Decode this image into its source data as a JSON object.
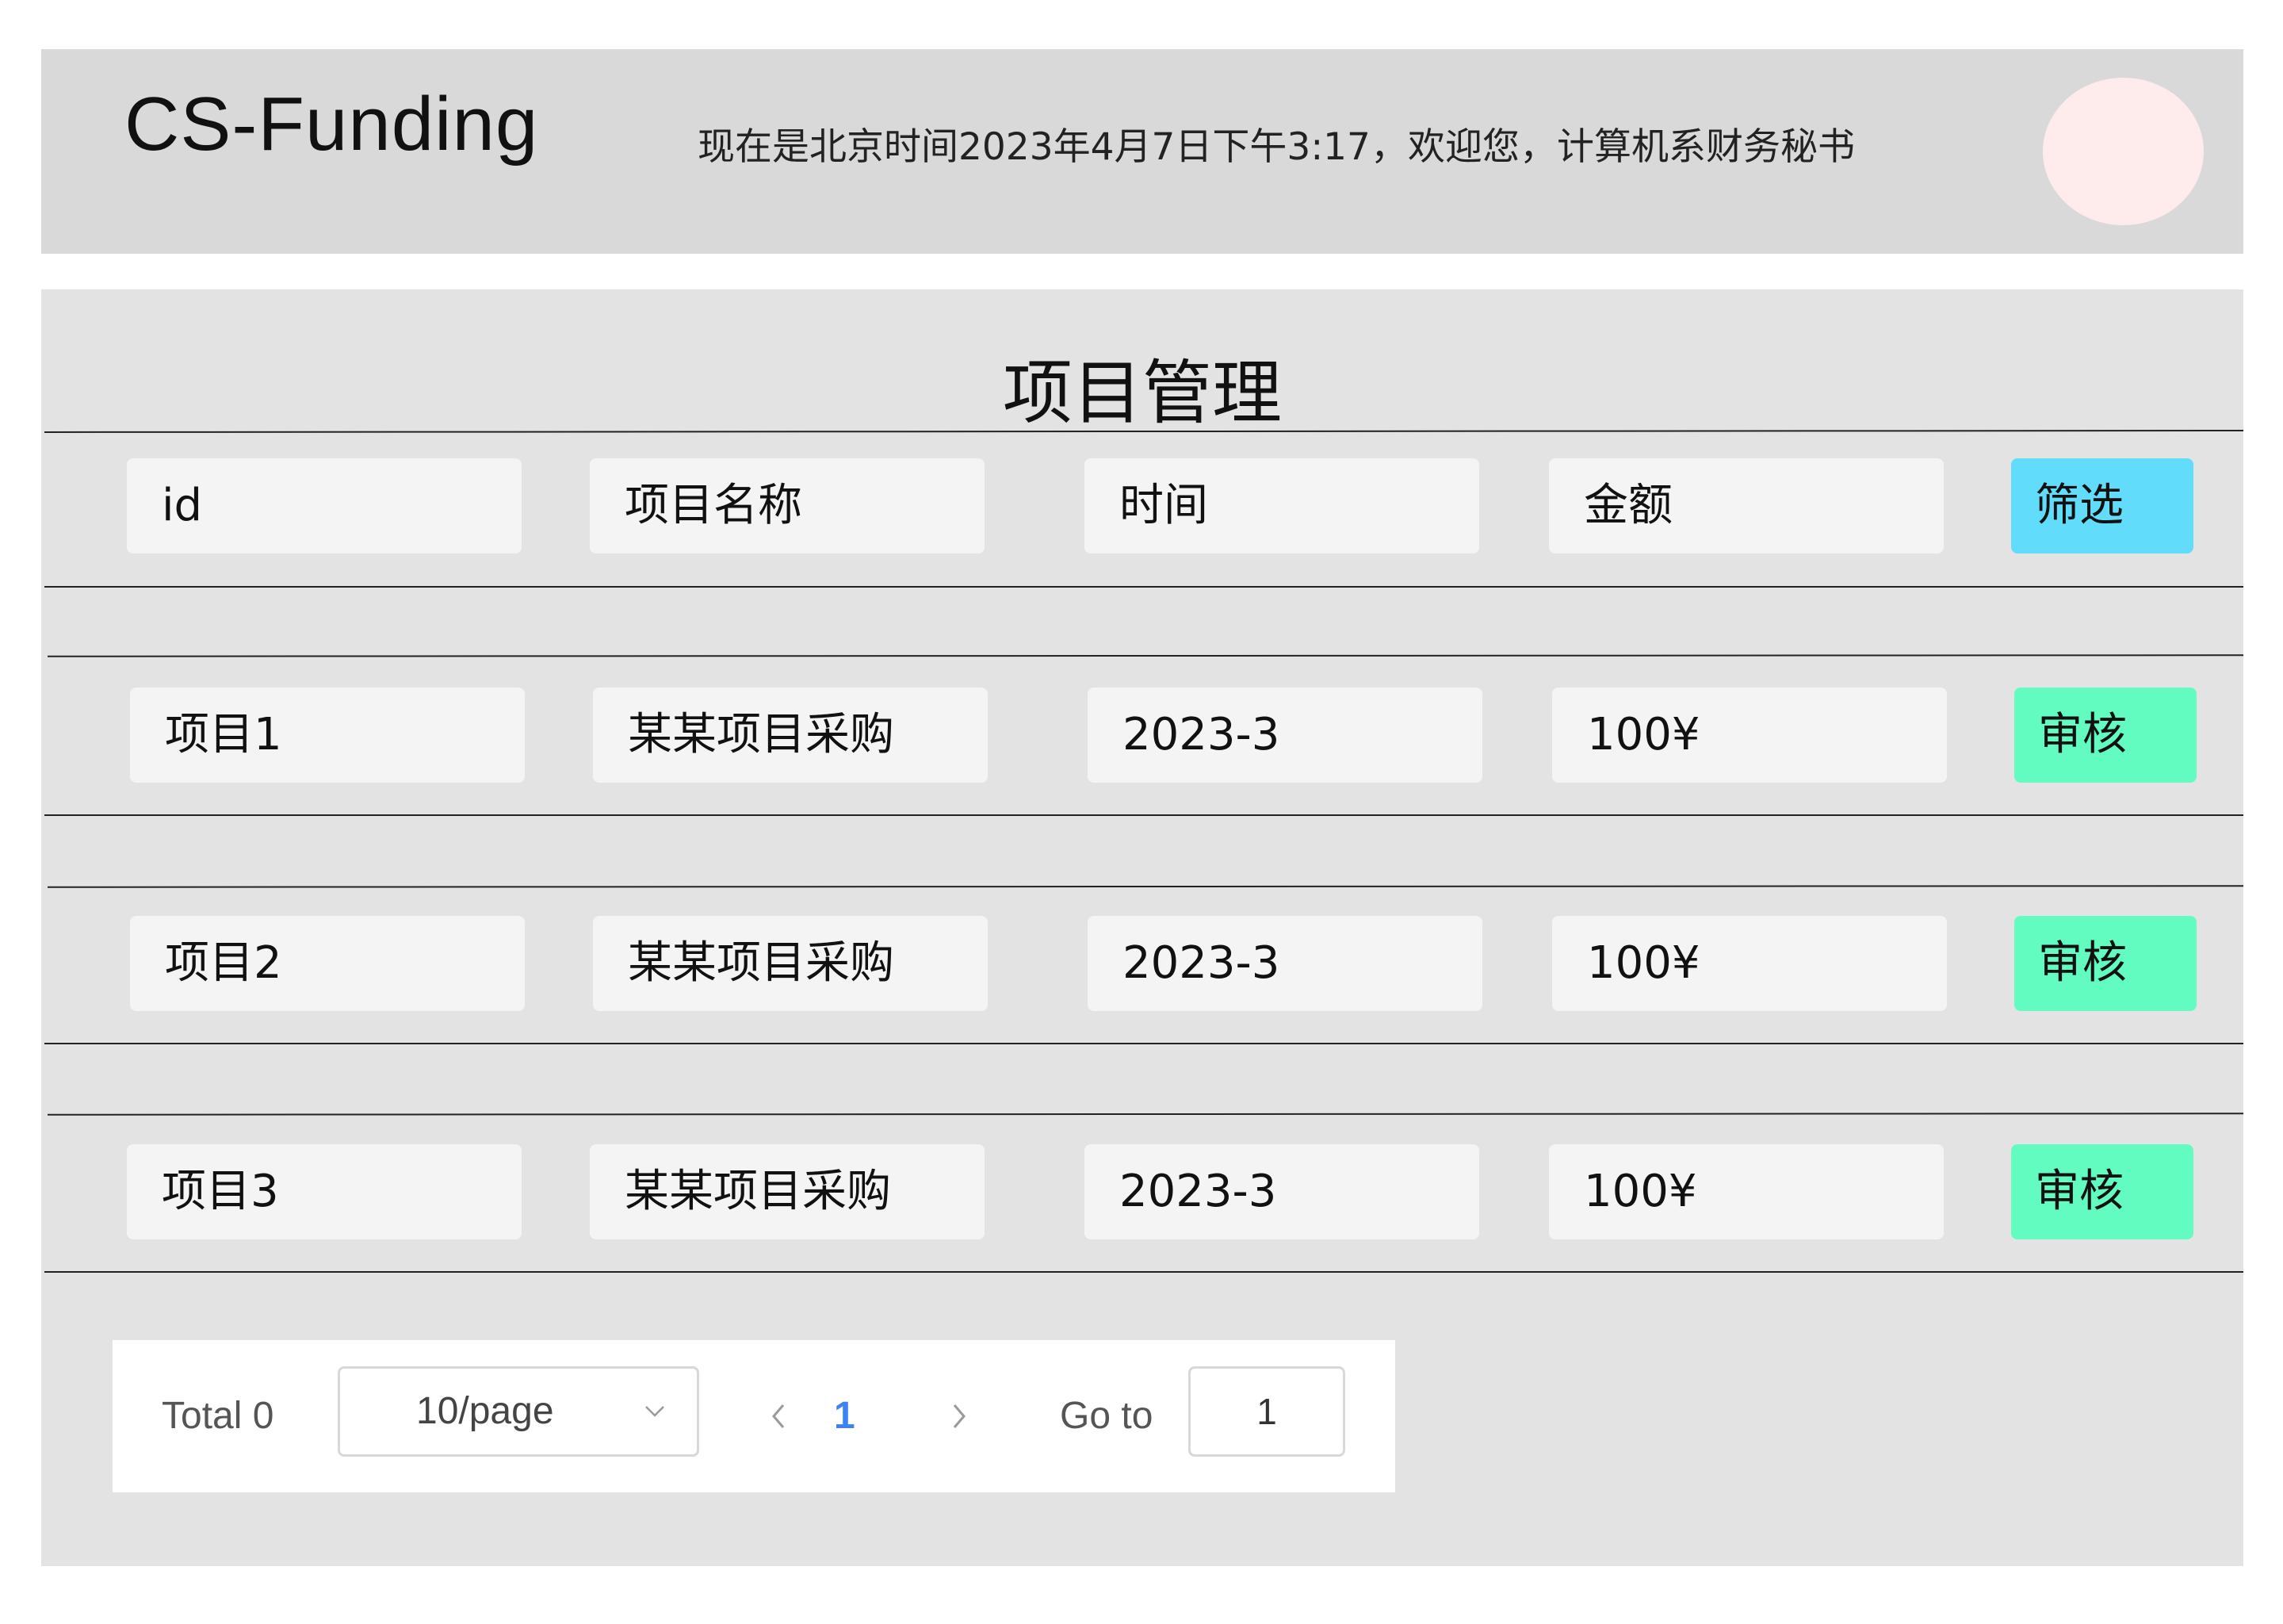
{
  "header": {
    "brand": "CS-Funding",
    "greeting": "现在是北京时间2023年4月7日下午3:17，欢迎您，计算机系财务秘书"
  },
  "page": {
    "title": "项目管理"
  },
  "filter": {
    "id_placeholder": "id",
    "name_placeholder": "项目名称",
    "time_placeholder": "时间",
    "amount_placeholder": "金额",
    "filter_button": "筛选"
  },
  "table": {
    "action_label": "审核",
    "rows": [
      {
        "id": "项目1",
        "name": "某某项目采购",
        "time": "2023-3",
        "amount": "100¥"
      },
      {
        "id": "项目2",
        "name": "某某项目采购",
        "time": "2023-3",
        "amount": "100¥"
      },
      {
        "id": "项目3",
        "name": "某某项目采购",
        "time": "2023-3",
        "amount": "100¥"
      }
    ]
  },
  "pagination": {
    "total_label": "Total 0",
    "page_size": "10/page",
    "current_page": "1",
    "goto_label": "Go to",
    "goto_value": "1"
  },
  "colors": {
    "header_bg": "#d9d9d9",
    "panel_bg": "#e3e3e3",
    "filter_button": "#62dcfb",
    "review_button": "#62fcc0",
    "avatar": "#fdeceb",
    "current_page": "#3b82f6"
  }
}
